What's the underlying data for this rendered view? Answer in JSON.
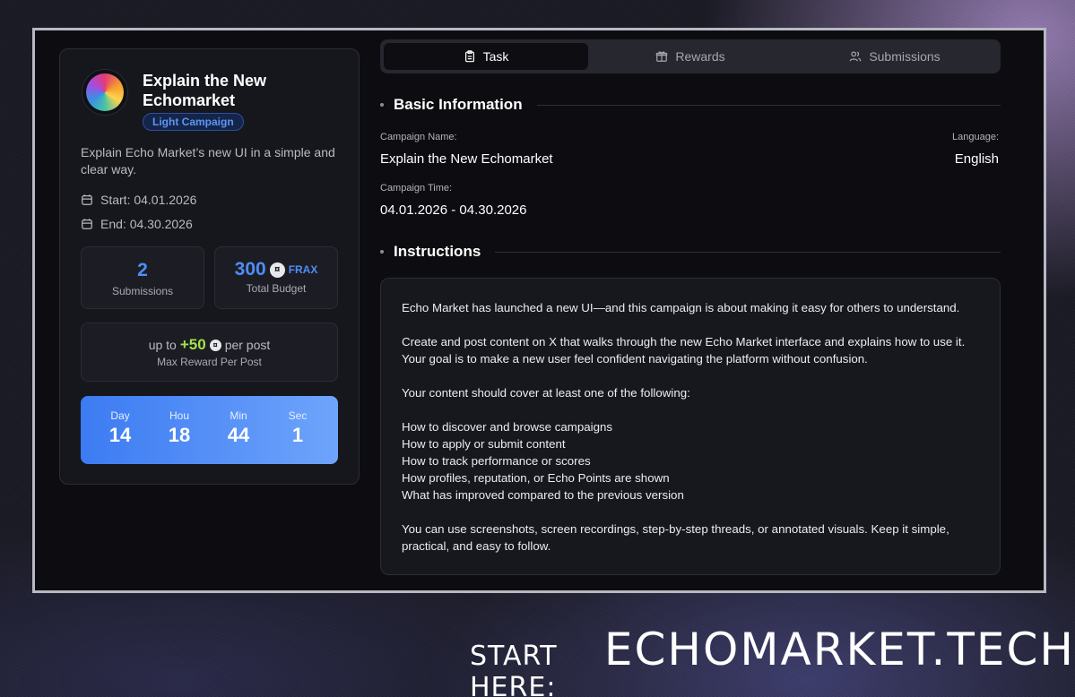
{
  "campaign": {
    "title": "Explain the New Echomarket",
    "badge": "Light Campaign",
    "description": "Explain Echo Market’s new UI in a simple and clear way.",
    "start": "Start: 04.01.2026",
    "end": "End: 04.30.2026",
    "submissions_count": "2",
    "submissions_label": "Submissions",
    "budget_value": "300",
    "budget_token": "FRAX",
    "budget_label": "Total Budget",
    "reward_prefix": "up to",
    "reward_value": "+50",
    "reward_suffix": "per post",
    "reward_label": "Max Reward Per Post",
    "countdown": [
      {
        "label": "Day",
        "value": "14"
      },
      {
        "label": "Hou",
        "value": "18"
      },
      {
        "label": "Min",
        "value": "44"
      },
      {
        "label": "Sec",
        "value": "1"
      }
    ]
  },
  "tabs": [
    {
      "label": "Task",
      "icon": "clipboard-icon",
      "active": true
    },
    {
      "label": "Rewards",
      "icon": "gift-icon",
      "active": false
    },
    {
      "label": "Submissions",
      "icon": "users-icon",
      "active": false
    }
  ],
  "basic_info": {
    "heading": "Basic Information",
    "name_label": "Campaign Name:",
    "name_value": "Explain the New Echomarket",
    "language_label": "Language:",
    "language_value": "English",
    "time_label": "Campaign Time:",
    "time_value": "04.01.2026 - 04.30.2026"
  },
  "instructions": {
    "heading": "Instructions",
    "para1": "Echo Market has launched a new UI—and this campaign is about making it easy for others to understand.",
    "para2": "Create and post content on X that walks through the new Echo Market interface and explains how to use it. Your goal is to make a new user feel confident navigating the platform without confusion.",
    "para3": "Your content should cover at least one of the following:",
    "items": [
      "How to discover and browse campaigns",
      "How to apply or submit content",
      "How to track performance or scores",
      "How profiles, reputation, or Echo Points are shown",
      "What has improved compared to the previous version"
    ],
    "para4": "You can use screenshots, screen recordings, step-by-step threads, or annotated visuals. Keep it simple, practical, and easy to follow."
  },
  "footer": {
    "lead": "START HERE:",
    "site": "ECHOMARKET.TECH"
  },
  "colors": {
    "accent": "#4f8df7",
    "reward_green": "#a5e04a",
    "countdown_start": "#3c7bf2",
    "countdown_end": "#6ea4fb"
  }
}
